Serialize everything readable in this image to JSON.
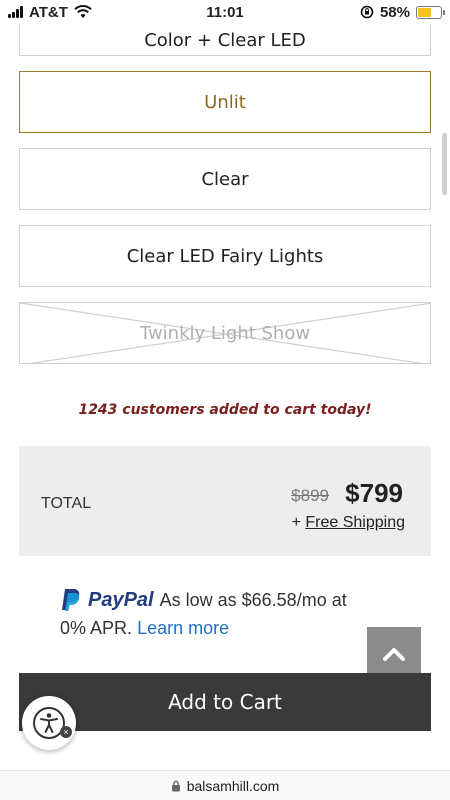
{
  "status_bar": {
    "carrier": "AT&T",
    "time": "11:01",
    "battery": "58%",
    "battery_level": 0.58
  },
  "options": [
    {
      "label": "Color + Clear LED",
      "state": "partial"
    },
    {
      "label": "Unlit",
      "state": "selected"
    },
    {
      "label": "Clear",
      "state": "default"
    },
    {
      "label": "Clear LED Fairy Lights",
      "state": "default"
    },
    {
      "label": "Twinkly Light Show",
      "state": "unavailable"
    }
  ],
  "urgency_text": "1243 customers added to cart today!",
  "total": {
    "label": "TOTAL",
    "old_price": "$899",
    "price": "$799",
    "shipping_prefix": "+ ",
    "shipping_link": "Free Shipping"
  },
  "paypal": {
    "brand": "PayPal",
    "text": "As low as $66.58/mo at",
    "apr": "0% APR.",
    "link": "Learn more"
  },
  "add_to_cart_label": "Add to Cart",
  "url": "balsamhill.com",
  "icons": {
    "wifi": "wifi-icon",
    "lock": "lock-icon",
    "scroll_top": "chevron-up-icon",
    "accessibility": "accessibility-icon"
  },
  "colors": {
    "selected_border": "#9a7b2f",
    "urgency": "#7a1f1f",
    "cart_button": "#3a3a3a",
    "paypal_blue": "#253b80",
    "link_blue": "#1f6fc5"
  }
}
